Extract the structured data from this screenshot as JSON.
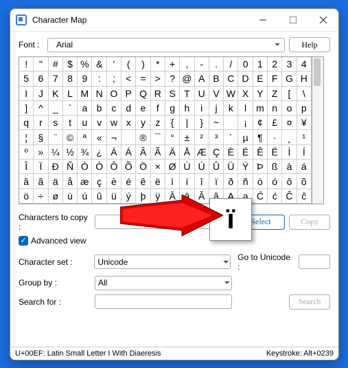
{
  "window_title": "Character Map",
  "font_label": "Font :",
  "font_selected": "Arial",
  "help_label": "Help",
  "grid_chars": [
    "!",
    "\"",
    "#",
    "$",
    "%",
    "&",
    "'",
    "(",
    ")",
    "*",
    "+",
    ",",
    "-",
    ".",
    "/",
    "0",
    "1",
    "2",
    "3",
    "4",
    "5",
    "6",
    "7",
    "8",
    "9",
    ":",
    ";",
    "<",
    "=",
    ">",
    "?",
    "@",
    "A",
    "B",
    "C",
    "D",
    "E",
    "F",
    "G",
    "H",
    "I",
    "J",
    "K",
    "L",
    "M",
    "N",
    "O",
    "P",
    "Q",
    "R",
    "S",
    "T",
    "U",
    "V",
    "W",
    "X",
    "Y",
    "Z",
    "[",
    "\\",
    "]",
    "^",
    "_",
    "`",
    "a",
    "b",
    "c",
    "d",
    "e",
    "f",
    "g",
    "h",
    "i",
    "j",
    "k",
    "l",
    "m",
    "n",
    "o",
    "p",
    "q",
    "r",
    "s",
    "t",
    "u",
    "v",
    "w",
    "x",
    "y",
    "z",
    "{",
    "|",
    "}",
    "~",
    "",
    "¡",
    "¢",
    "£",
    "¤",
    "¥",
    "¦",
    "§",
    "¨",
    "©",
    "ª",
    "«",
    "¬",
    "",
    "®",
    "¯",
    "°",
    "±",
    "²",
    "³",
    "´",
    "µ",
    "¶",
    "·",
    "¸",
    "¹",
    "º",
    "»",
    "¼",
    "½",
    "¾",
    "¿",
    "À",
    "Á",
    "Â",
    "Ã",
    "Ä",
    "Å",
    "Æ",
    "Ç",
    "È",
    "É",
    "Ê",
    "Ë",
    "Ì",
    "Í",
    "Î",
    "Ï",
    "Ð",
    "Ñ",
    "Ò",
    "Ó",
    "Ô",
    "Õ",
    "Ö",
    "×",
    "Ø",
    "Ù",
    "Ú",
    "Û",
    "Ü",
    "Ý",
    "Þ",
    "ß",
    "à",
    "á",
    "â",
    "ã",
    "ä",
    "å",
    "æ",
    "ç",
    "è",
    "é",
    "ê",
    "ë",
    "ì",
    "í",
    "î",
    "ï",
    "ð",
    "ñ",
    "ò",
    "ó",
    "ô",
    "õ",
    "ö",
    "÷",
    "ø",
    "ù",
    "ú",
    "û",
    "ü",
    "ý",
    "þ",
    "ÿ",
    "Ā",
    "ā",
    "Ă",
    "ă",
    "Ą",
    "ą",
    "Ć",
    "ć",
    "Ĉ",
    "ĉ"
  ],
  "popup_char": "ï",
  "chars_to_copy_label": "Characters to copy :",
  "chars_to_copy_value": "",
  "select_label": "Select",
  "copy_label": "Copy",
  "advanced_label": "Advanced view",
  "charset_label": "Character set :",
  "charset_value": "Unicode",
  "goto_label": "Go to Unicode :",
  "goto_value": "",
  "groupby_label": "Group by :",
  "groupby_value": "All",
  "searchfor_label": "Search for :",
  "searchfor_value": "",
  "search_btn": "Search",
  "status_left": "U+00EF: Latin Small Letter I With Diaeresis",
  "status_right": "Keystroke: Alt+0239"
}
